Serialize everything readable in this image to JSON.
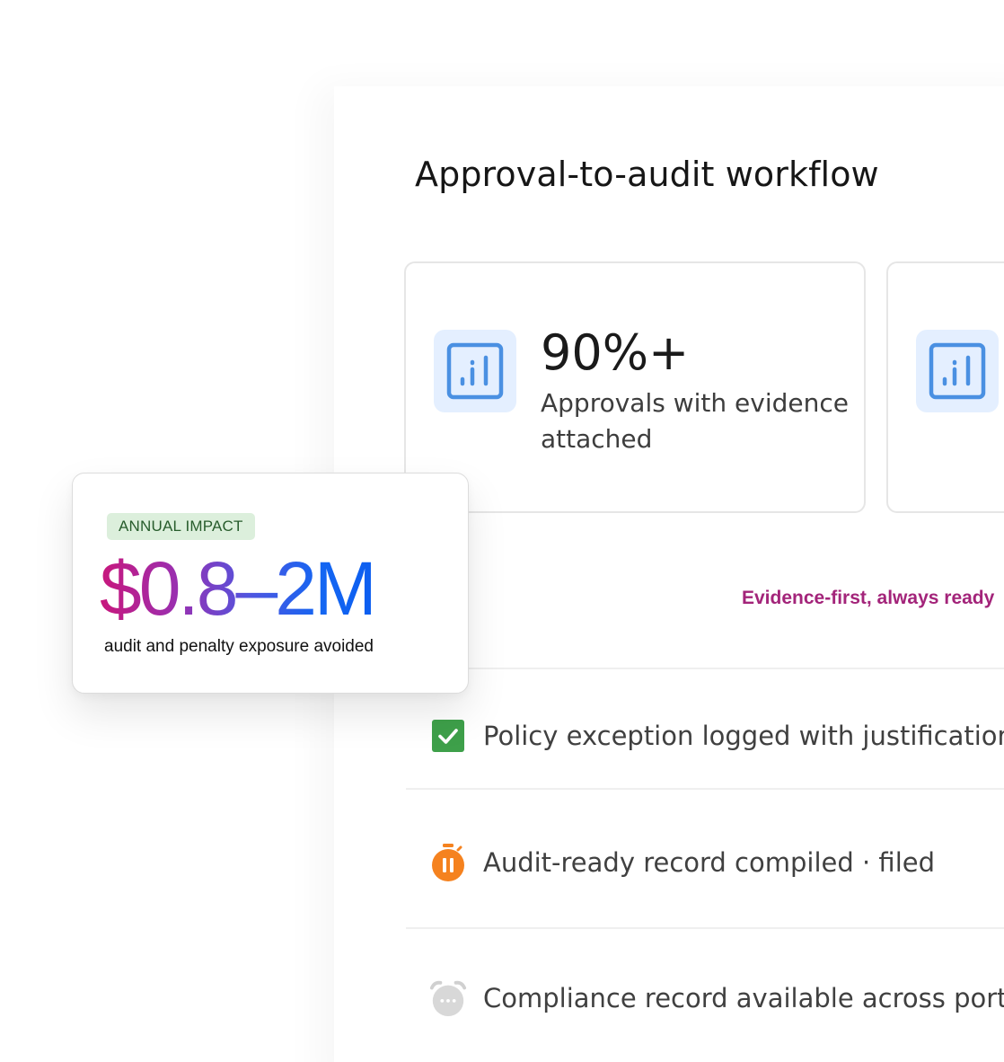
{
  "panel": {
    "title": "Approval-to-audit workflow"
  },
  "stats": [
    {
      "icon": "bar-chart-icon",
      "value": "90%+",
      "label": "Approvals with evidence attached"
    },
    {
      "icon": "bar-chart-icon"
    }
  ],
  "tagline": "Evidence-first, always ready",
  "rows": [
    {
      "icon": "checkbox-checked-icon",
      "label": "Policy exception logged with justification",
      "status": "done"
    },
    {
      "icon": "stopwatch-paused-icon",
      "label": "Audit-ready record compiled · filed",
      "status": "in-progress"
    },
    {
      "icon": "alarm-clock-pending-icon",
      "label": "Compliance record available across portfolio",
      "status": "pending"
    }
  ],
  "impact": {
    "badge": "ANNUAL IMPACT",
    "value": "$0.8–2M",
    "subtitle": "audit and penalty exposure avoided"
  },
  "colors": {
    "accent_icon_bg": "#e4efff",
    "accent_icon_fg": "#4a90e2",
    "tagline": "#a3247a",
    "check_green": "#3ea04a",
    "timer_orange": "#f5821f",
    "pending_gray": "#d5d5d5",
    "badge_bg": "#dcefdc",
    "badge_fg": "#275c2c",
    "gradient": [
      "#c8177c",
      "#9a2fb0",
      "#4f56e0",
      "#1466f2"
    ]
  }
}
